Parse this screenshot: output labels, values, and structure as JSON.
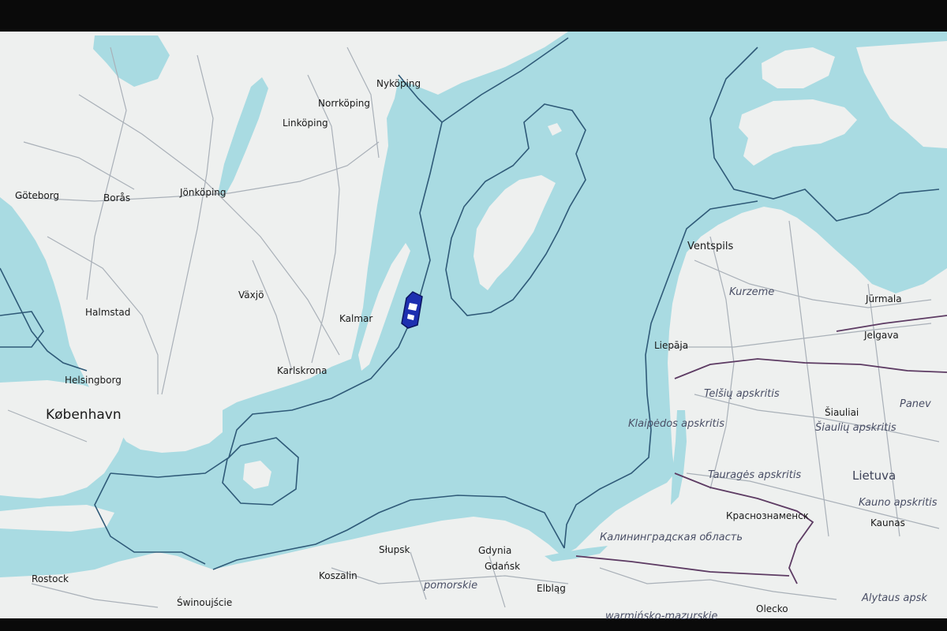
{
  "map": {
    "colors": {
      "sea": "#a9dbe2",
      "land": "#eef0ef",
      "roads": "#a9b0b8",
      "boundary": "#2f5a78",
      "admin_border": "#5d3b63",
      "place_label": "#1a1a1a",
      "region_label": "#4a4f66",
      "ship": "#1d2fb0"
    },
    "places": {
      "nykoping": "Nyköping",
      "norrkoping": "Norrköping",
      "linkoping": "Linköping",
      "goteborg": "Göteborg",
      "boras": "Borås",
      "jonkoping": "Jönköping",
      "halmstad": "Halmstad",
      "vaxjo": "Växjö",
      "kalmar": "Kalmar",
      "karlskrona": "Karlskrona",
      "helsingborg": "Helsingborg",
      "kobenhavn": "København",
      "ventspils": "Ventspils",
      "jurmala": "Jūrmala",
      "jelgava": "Jelgava",
      "liepaja": "Liepāja",
      "siauliai": "Šiauliai",
      "krasnoznamensk": "Краснознаменск",
      "kaunas": "Kaunas",
      "rostock": "Rostock",
      "swinoujscie": "Świnoujście",
      "koszalin": "Koszalin",
      "slupsk": "Słupsk",
      "gdynia": "Gdynia",
      "gdansk": "Gdańsk",
      "elblag": "Elbląg",
      "olecko": "Olecko"
    },
    "regions": {
      "kurzeme": "Kurzeme",
      "telsiu": "Telšių apskritis",
      "siauliu": "Šiaulių apskritis",
      "panevezys": "Panev",
      "klaipedos": "Klaipėdos apskritis",
      "taurages": "Tauragės apskritis",
      "lietuva": "Lietuva",
      "kauno": "Kauno apskritis",
      "kaliningrad": "Калининградская область",
      "pomorskie": "pomorskie",
      "warminsko": "warmińsko-mazurskie",
      "alytaus": "Alytaus apsk"
    },
    "marker": {
      "icon": "ship-icon"
    }
  }
}
